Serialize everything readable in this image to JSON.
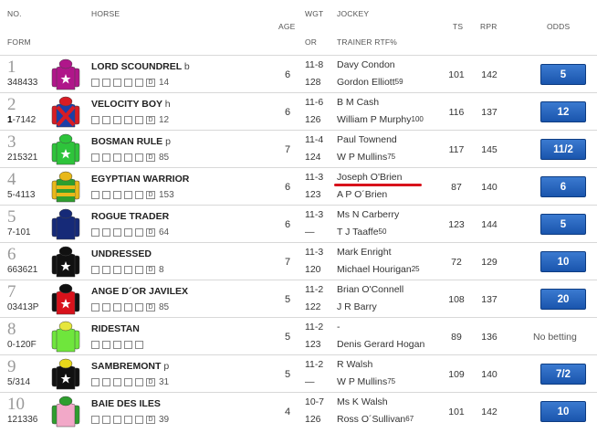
{
  "headers": {
    "no": "NO.",
    "horse": "HORSE",
    "form": "FORM",
    "age": "AGE",
    "wgt": "WGT",
    "or": "OR",
    "jockey": "JOCKEY",
    "trainer": "TRAINER RTF%",
    "ts": "TS",
    "rpr": "RPR",
    "odds": "ODDS"
  },
  "runners": [
    {
      "no": "1",
      "form": "348433",
      "form_bold": "",
      "name": "LORD SCOUNDREL",
      "suffix": "b",
      "tval": "14",
      "age": "6",
      "wgt": "11-8",
      "or": "128",
      "jockey": "Davy Condon",
      "trainer": "Gordon Elliott",
      "rtf": "59",
      "ts": "101",
      "rpr": "142",
      "odds": "5",
      "silk": {
        "body": "#b0168a",
        "sleeve": "#b0168a",
        "cap": "#b0168a",
        "star": true,
        "sash": false,
        "stripes": false
      }
    },
    {
      "no": "2",
      "form": "-7142",
      "form_bold": "1",
      "name": "VELOCITY BOY",
      "suffix": "h",
      "tval": "12",
      "age": "6",
      "wgt": "11-6",
      "or": "126",
      "jockey": "B M Cash",
      "trainer": "William P Murphy",
      "rtf": "100",
      "ts": "116",
      "rpr": "137",
      "odds": "12",
      "silk": {
        "body": "#1b3fa8",
        "sleeve": "#d81c24",
        "cap": "#d81c24",
        "star": false,
        "sash": true,
        "stripes": false
      }
    },
    {
      "no": "3",
      "form": "215321",
      "form_bold": "",
      "name": "BOSMAN RULE",
      "suffix": "p",
      "tval": "85",
      "age": "7",
      "wgt": "11-4",
      "or": "124",
      "jockey": "Paul Townend",
      "trainer": "W P Mullins",
      "rtf": "75",
      "ts": "117",
      "rpr": "145",
      "odds": "11/2",
      "silk": {
        "body": "#2ec43b",
        "sleeve": "#2ec43b",
        "cap": "#2ec43b",
        "star": true,
        "sash": false,
        "stripes": false
      }
    },
    {
      "no": "4",
      "form": "5-4113",
      "form_bold": "",
      "name": "EGYPTIAN WARRIOR",
      "suffix": "",
      "tval": "153",
      "age": "6",
      "wgt": "11-3",
      "or": "123",
      "jockey": "Joseph O'Brien",
      "trainer": "A P O´Brien",
      "rtf": "",
      "ts": "87",
      "rpr": "140",
      "odds": "6",
      "silk": {
        "body": "#2e9e2e",
        "sleeve": "#e8b81a",
        "cap": "#e8b81a",
        "star": false,
        "sash": false,
        "stripes": true
      }
    },
    {
      "no": "5",
      "form": "7-101",
      "form_bold": "",
      "name": "ROGUE TRADER",
      "suffix": "",
      "tval": "64",
      "age": "6",
      "wgt": "11-3",
      "or": "—",
      "jockey": "Ms N Carberry",
      "trainer": "T J Taaffe",
      "rtf": "50",
      "ts": "123",
      "rpr": "144",
      "odds": "5",
      "silk": {
        "body": "#162a78",
        "sleeve": "#162a78",
        "cap": "#162a78",
        "star": false,
        "sash": false,
        "stripes": false
      }
    },
    {
      "no": "6",
      "form": "663621",
      "form_bold": "",
      "name": "UNDRESSED",
      "suffix": "",
      "tval": "8",
      "age": "7",
      "wgt": "11-3",
      "or": "120",
      "jockey": "Mark Enright",
      "trainer": "Michael Hourigan",
      "rtf": "25",
      "ts": "72",
      "rpr": "129",
      "odds": "10",
      "silk": {
        "body": "#111111",
        "sleeve": "#111111",
        "cap": "#111111",
        "star": true,
        "sash": false,
        "stripes": false
      }
    },
    {
      "no": "7",
      "form": "03413P",
      "form_bold": "",
      "name": "ANGE D´OR JAVILEX",
      "suffix": "",
      "tval": "85",
      "age": "5",
      "wgt": "11-2",
      "or": "122",
      "jockey": "Brian O'Connell",
      "trainer": "J R Barry",
      "rtf": "",
      "ts": "108",
      "rpr": "137",
      "odds": "20",
      "silk": {
        "body": "#d8121b",
        "sleeve": "#111111",
        "cap": "#111111",
        "star": true,
        "sash": false,
        "stripes": false
      }
    },
    {
      "no": "8",
      "form": "0-120F",
      "form_bold": "",
      "name": "RIDESTAN",
      "suffix": "",
      "tval": "",
      "age": "5",
      "wgt": "11-2",
      "or": "123",
      "jockey": "-",
      "trainer": "Denis Gerard Hogan",
      "rtf": "",
      "ts": "89",
      "rpr": "136",
      "odds": "No betting",
      "silk": {
        "body": "#6fe63c",
        "sleeve": "#6fe63c",
        "cap": "#e6e63c",
        "star": false,
        "sash": false,
        "stripes": false
      }
    },
    {
      "no": "9",
      "form": "5/314",
      "form_bold": "",
      "name": "SAMBREMONT",
      "suffix": "p",
      "tval": "31",
      "age": "5",
      "wgt": "11-2",
      "or": "—",
      "jockey": "R Walsh",
      "trainer": "W P Mullins",
      "rtf": "75",
      "ts": "109",
      "rpr": "140",
      "odds": "7/2",
      "silk": {
        "body": "#111111",
        "sleeve": "#111111",
        "cap": "#e8d81a",
        "star": true,
        "sash": false,
        "stripes": false
      }
    },
    {
      "no": "10",
      "form": "121336",
      "form_bold": "",
      "name": "BAIE DES ILES",
      "suffix": "",
      "tval": "39",
      "age": "4",
      "wgt": "10-7",
      "or": "126",
      "jockey": "Ms K Walsh",
      "trainer": "Ross O´Sullivan",
      "rtf": "67",
      "ts": "101",
      "rpr": "142",
      "odds": "10",
      "silk": {
        "body": "#f2a8c8",
        "sleeve": "#2e9e2e",
        "cap": "#2e9e2e",
        "star": false,
        "sash": false,
        "stripes": false
      }
    }
  ]
}
